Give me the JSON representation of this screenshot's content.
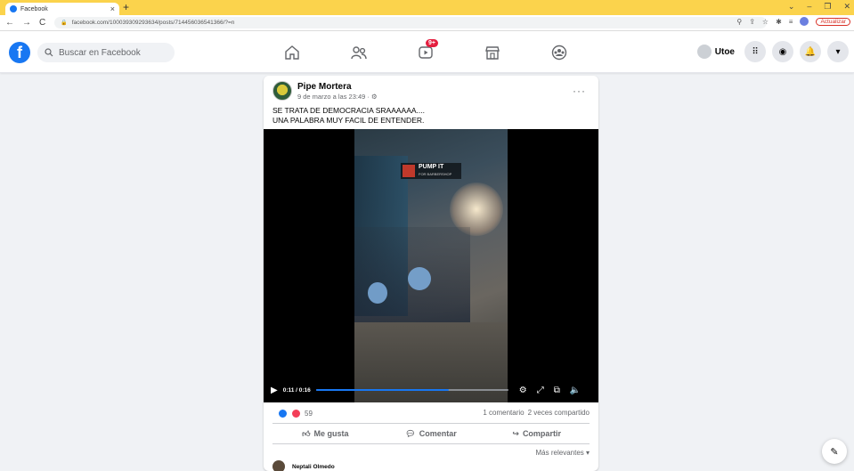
{
  "browser": {
    "tab_title": "Facebook",
    "tab_close": "×",
    "new_tab": "+",
    "url": "facebook.com/100039309293634/posts/714456036541366/?=n",
    "update_label": "Actualizar",
    "window_controls": [
      "⌄",
      "–",
      "❐",
      "✕"
    ]
  },
  "header": {
    "logo": "f",
    "search_placeholder": "Buscar en Facebook",
    "watch_badge": "9+",
    "user_name": "Utoe"
  },
  "post": {
    "author": "Pipe Mortera",
    "date": "9 de marzo a las 23:49 · ⚙",
    "more": "···",
    "text_line1": "SE TRATA DE DEMOCRACIA SRAAAAAA....",
    "text_line2": "UNA PALABRA MUY FACIL DE ENTENDER.",
    "video": {
      "overlay_title": "PUMP IT",
      "overlay_sub": "FOR BARBERSHOP",
      "time": "0:11 / 0:16",
      "progress": 0.69
    },
    "reactions_count": "59",
    "comments_count": "1 comentario",
    "shares_count": "2 veces compartido",
    "actions": {
      "like": "Me gusta",
      "comment": "Comentar",
      "share": "Compartir"
    },
    "sort_label": "Más relevantes ▾",
    "first_commenter": "Neptali Olmedo"
  },
  "colors": {
    "brand": "#1877f2",
    "tabbar": "#fbd34c",
    "badge": "#e41e3f"
  }
}
